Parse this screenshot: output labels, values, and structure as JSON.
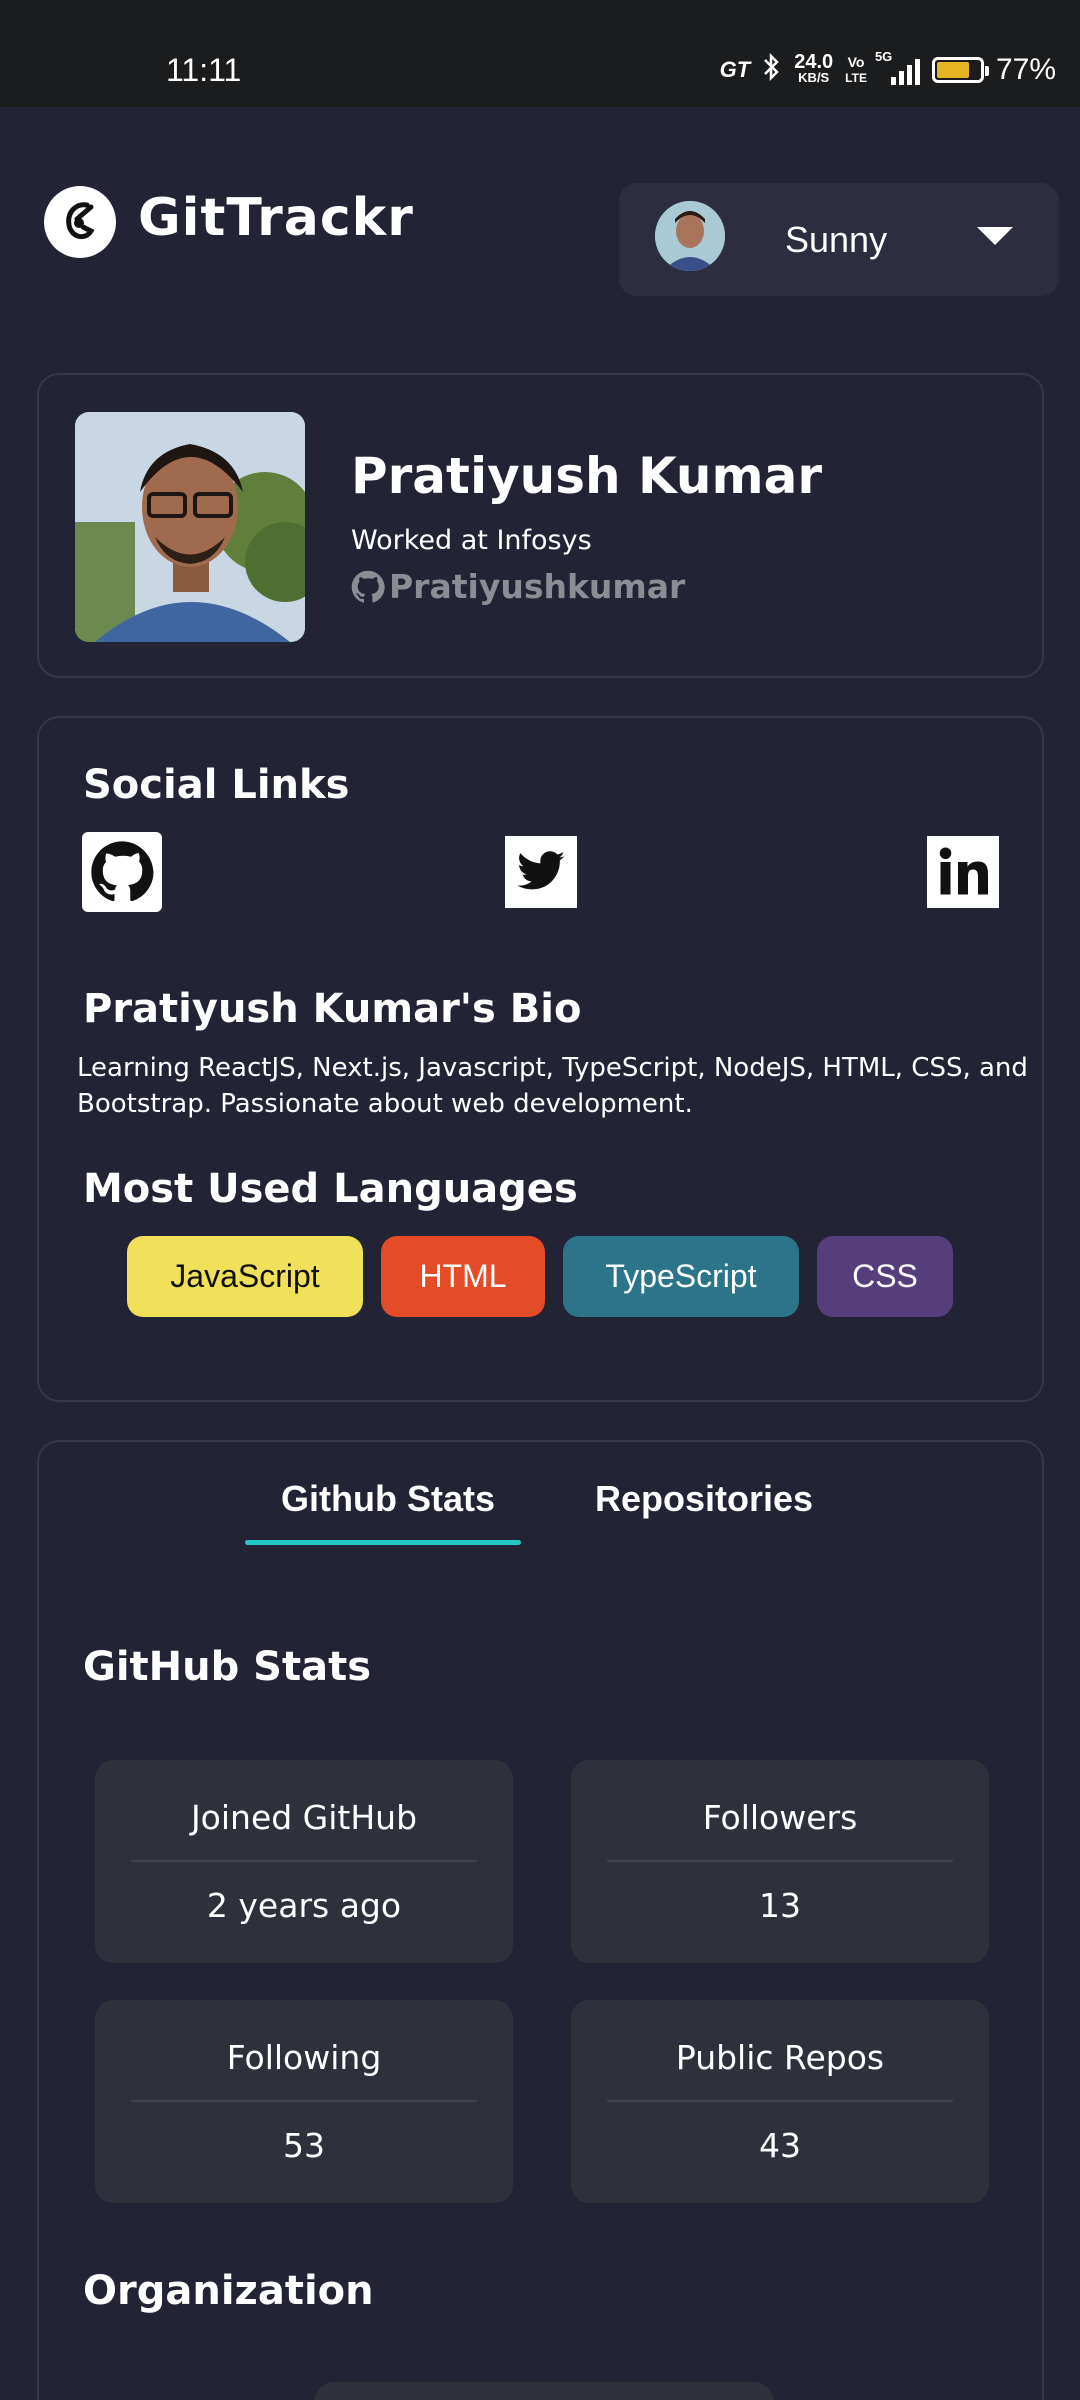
{
  "status_bar": {
    "time": "11:11",
    "net_speed_top": "24.0",
    "net_speed_unit": "KB/S",
    "volte_top": "Vo",
    "volte_bottom": "LTE",
    "network": "5G",
    "battery_percent": "77%",
    "battery_level": 0.77,
    "battery_color": "#e6b422"
  },
  "header": {
    "app_name": "GitTrackr",
    "logo_icon": "git-logo-icon",
    "user_name": "Sunny"
  },
  "profile": {
    "name": "Pratiyush Kumar",
    "work": "Worked at Infosys",
    "github_handle": "Pratiyushkumar"
  },
  "social": {
    "heading": "Social Links",
    "links": [
      "github-icon",
      "twitter-icon",
      "linkedin-icon"
    ],
    "bio_heading": "Pratiyush Kumar's Bio",
    "bio": "Learning ReactJS, Next.js, Javascript, TypeScript, NodeJS, HTML, CSS, and Bootstrap. Passionate about web development.",
    "languages_heading": "Most Used Languages",
    "languages": [
      {
        "label": "JavaScript",
        "bg": "#f1e05a",
        "fg": "#111111"
      },
      {
        "label": "HTML",
        "bg": "#e34c26",
        "fg": "#ffffff"
      },
      {
        "label": "TypeScript",
        "bg": "#2b7489",
        "fg": "#ffffff"
      },
      {
        "label": "CSS",
        "bg": "#563d7c",
        "fg": "#ffffff"
      }
    ]
  },
  "stats": {
    "tabs": [
      "Github Stats",
      "Repositories"
    ],
    "active_tab": "Github Stats",
    "heading": "GitHub Stats",
    "items": [
      {
        "label": "Joined GitHub",
        "value": "2 years ago"
      },
      {
        "label": "Followers",
        "value": "13"
      },
      {
        "label": "Following",
        "value": "53"
      },
      {
        "label": "Public Repos",
        "value": "43"
      }
    ],
    "org_heading": "Organization"
  },
  "colors": {
    "background": "#222334",
    "card_border": "#34364a",
    "stat_box": "#2e303b",
    "tab_accent": "#24c6c4"
  }
}
